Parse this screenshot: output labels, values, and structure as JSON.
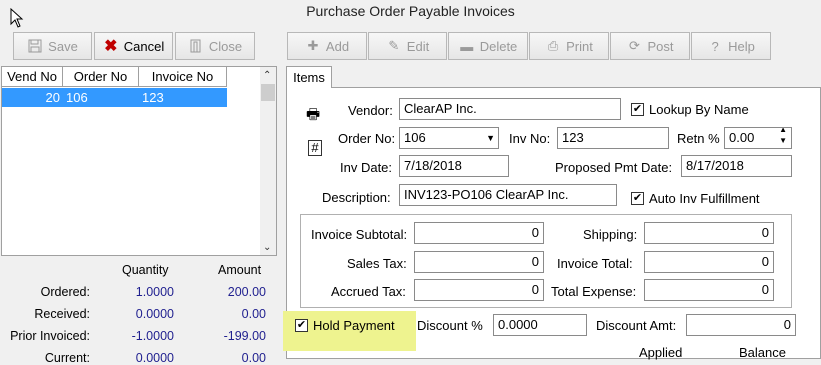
{
  "window": {
    "title": "Purchase Order Payable Invoices"
  },
  "toolbar_left": [
    {
      "label": "Save",
      "icon": "save-icon",
      "enabled": false
    },
    {
      "label": "Cancel",
      "icon": "cancel-icon",
      "enabled": true
    },
    {
      "label": "Close",
      "icon": "close-icon",
      "enabled": false
    }
  ],
  "toolbar_right": [
    {
      "label": "Add",
      "icon": "add-icon",
      "enabled": false
    },
    {
      "label": "Edit",
      "icon": "edit-icon",
      "enabled": false
    },
    {
      "label": "Delete",
      "icon": "delete-icon",
      "enabled": false
    },
    {
      "label": "Print",
      "icon": "print-icon",
      "enabled": false
    },
    {
      "label": "Post",
      "icon": "post-icon",
      "enabled": false
    },
    {
      "label": "Help",
      "icon": "help-icon",
      "enabled": false
    }
  ],
  "grid": {
    "columns": [
      "Vend No",
      "Order No",
      "Invoice No"
    ],
    "rows": [
      {
        "vend_no": "20",
        "order_no": "106",
        "invoice_no": "123"
      }
    ]
  },
  "summary": {
    "headers": {
      "quantity": "Quantity",
      "amount": "Amount"
    },
    "rows": [
      {
        "label": "Ordered:",
        "quantity": "1.0000",
        "amount": "200.00"
      },
      {
        "label": "Received:",
        "quantity": "0.0000",
        "amount": "0.00"
      },
      {
        "label": "Prior Invoiced:",
        "quantity": "-1.0000",
        "amount": "-199.00"
      },
      {
        "label": "Current:",
        "quantity": "0.0000",
        "amount": "0.00"
      }
    ]
  },
  "tab": {
    "label": "Items"
  },
  "form": {
    "vendor_label": "Vendor:",
    "vendor": "ClearAP Inc.",
    "lookup_by_name_label": "Lookup By Name",
    "lookup_by_name": true,
    "order_no_label": "Order No:",
    "order_no": "106",
    "inv_no_label": "Inv No:",
    "inv_no": "123",
    "retn_label": "Retn %",
    "retn": "0.00",
    "inv_date_label": "Inv Date:",
    "inv_date": "7/18/2018",
    "pmt_date_label": "Proposed Pmt Date:",
    "pmt_date": "8/17/2018",
    "description_label": "Description:",
    "description": "INV123-PO106 ClearAP Inc.",
    "auto_inv_label": "Auto Inv Fulfillment",
    "auto_inv": true,
    "invoice_subtotal_label": "Invoice Subtotal:",
    "invoice_subtotal": "0",
    "shipping_label": "Shipping:",
    "shipping": "0",
    "sales_tax_label": "Sales Tax:",
    "sales_tax": "0",
    "invoice_total_label": "Invoice Total:",
    "invoice_total": "0",
    "accrued_tax_label": "Accrued Tax:",
    "accrued_tax": "0",
    "total_expense_label": "Total Expense:",
    "total_expense": "0",
    "hold_payment_label": "Hold Payment",
    "hold_payment": true,
    "discount_pct_label": "Discount %",
    "discount_pct": "0.0000",
    "discount_amt_label": "Discount Amt:",
    "discount_amt": "0",
    "applied_label": "Applied",
    "balance_label": "Balance"
  },
  "colors": {
    "selection": "#3399ff",
    "hold_highlight": "#eef38f",
    "number": "#1f1f8f",
    "cancel": "#c00000"
  }
}
